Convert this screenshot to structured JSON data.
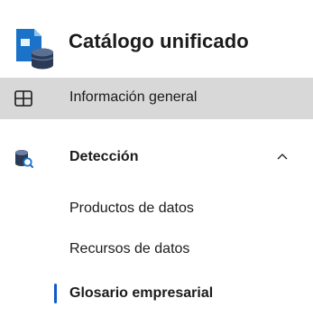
{
  "header": {
    "title": "Catálogo unificado",
    "icon": "unified-catalog-icon"
  },
  "nav": {
    "items": [
      {
        "label": "Información general",
        "icon": "overview-grid-icon",
        "selected": true
      },
      {
        "label": "Detección",
        "icon": "discovery-database-search-icon",
        "expanded": true,
        "chevron": "chevron-up-icon",
        "children": [
          {
            "label": "Productos de datos"
          },
          {
            "label": "Recursos de datos"
          },
          {
            "label": "Glosario empresarial",
            "active": true
          }
        ]
      }
    ]
  },
  "colors": {
    "selected_background": "#d8d8d8",
    "active_indicator": "#1159c7",
    "icon_blue": "#1a73c8",
    "icon_dark": "#2b3a55",
    "text": "#1b1b1b"
  }
}
